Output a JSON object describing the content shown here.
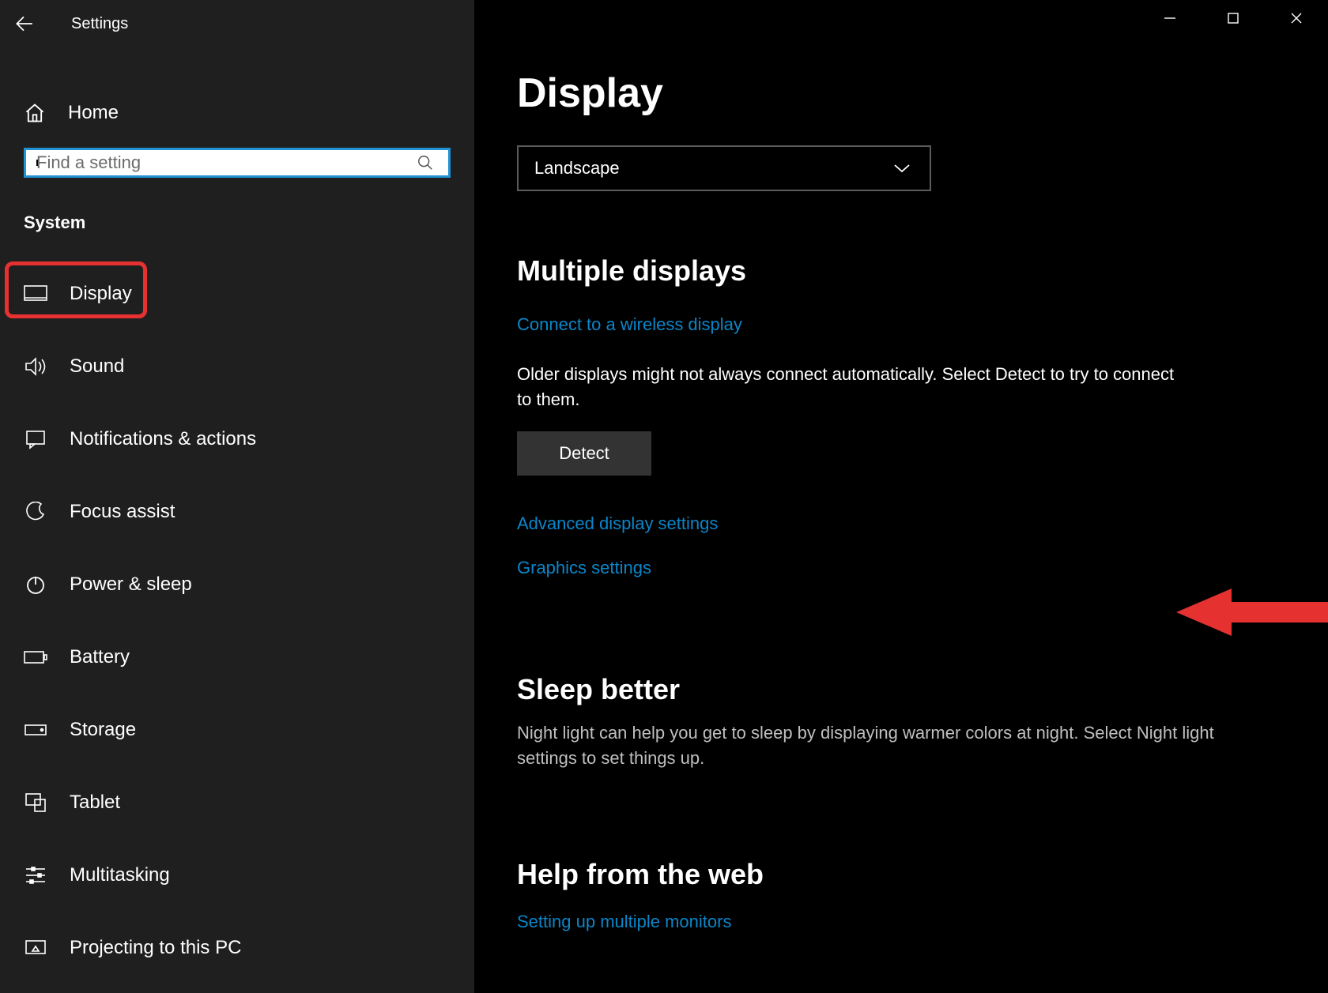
{
  "titlebar": {
    "title": "Settings"
  },
  "sidebar": {
    "home_label": "Home",
    "search_placeholder": "Find a setting",
    "category_label": "System",
    "items": [
      {
        "label": "Display"
      },
      {
        "label": "Sound"
      },
      {
        "label": "Notifications & actions"
      },
      {
        "label": "Focus assist"
      },
      {
        "label": "Power & sleep"
      },
      {
        "label": "Battery"
      },
      {
        "label": "Storage"
      },
      {
        "label": "Tablet"
      },
      {
        "label": "Multitasking"
      },
      {
        "label": "Projecting to this PC"
      }
    ]
  },
  "content": {
    "page_title": "Display",
    "orientation_select_value": "Landscape",
    "multiple_displays": {
      "heading": "Multiple displays",
      "connect_link": "Connect to a wireless display",
      "older_text": "Older displays might not always connect automatically. Select Detect to try to connect to them.",
      "detect_button": "Detect",
      "advanced_link": "Advanced display settings",
      "graphics_link": "Graphics settings"
    },
    "sleep_better": {
      "heading": "Sleep better",
      "text": "Night light can help you get to sleep by displaying warmer colors at night. Select Night light settings to set things up."
    },
    "help_web": {
      "heading": "Help from the web",
      "setup_link": "Setting up multiple monitors"
    }
  }
}
